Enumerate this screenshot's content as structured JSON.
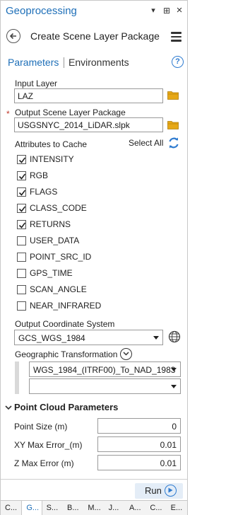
{
  "titlebar": {
    "title": "Geoprocessing",
    "pin": "▾",
    "autohide": "⊞",
    "close": "×"
  },
  "header": {
    "title": "Create Scene Layer Package"
  },
  "tabs": {
    "parameters": "Parameters",
    "environments": "Environments",
    "help": "?"
  },
  "input_layer": {
    "label": "Input Layer",
    "value": "LAZ"
  },
  "output_package": {
    "required_mark": "*",
    "label": "Output Scene Layer Package",
    "value": "USGSNYC_2014_LiDAR.slpk"
  },
  "attributes": {
    "label": "Attributes to Cache",
    "select_all": "Select All",
    "items": [
      {
        "name": "INTENSITY",
        "checked": true
      },
      {
        "name": "RGB",
        "checked": true
      },
      {
        "name": "FLAGS",
        "checked": true
      },
      {
        "name": "CLASS_CODE",
        "checked": true
      },
      {
        "name": "RETURNS",
        "checked": true
      },
      {
        "name": "USER_DATA",
        "checked": false
      },
      {
        "name": "POINT_SRC_ID",
        "checked": false
      },
      {
        "name": "GPS_TIME",
        "checked": false
      },
      {
        "name": "SCAN_ANGLE",
        "checked": false
      },
      {
        "name": "NEAR_INFRARED",
        "checked": false
      }
    ]
  },
  "coordinate_system": {
    "label": "Output Coordinate System",
    "value": "GCS_WGS_1984"
  },
  "geo_transform": {
    "label": "Geographic Transformation",
    "value": "WGS_1984_(ITRF00)_To_NAD_1983",
    "value2": ""
  },
  "point_cloud": {
    "section_title": "Point Cloud Parameters",
    "point_size_label": "Point Size (m)",
    "point_size_value": "0",
    "xy_error_label": "XY Max Error_(m)",
    "xy_error_value": "0.01",
    "z_error_label": "Z Max Error (m)",
    "z_error_value": "0.01"
  },
  "footer": {
    "run": "Run"
  },
  "bottom_tabs": [
    "C...",
    "G...",
    "S...",
    "B...",
    "M...",
    "J...",
    "A...",
    "C...",
    "E..."
  ],
  "colors": {
    "accent": "#1e6fb8",
    "folder": "#e6a817",
    "required": "#c0392b"
  }
}
